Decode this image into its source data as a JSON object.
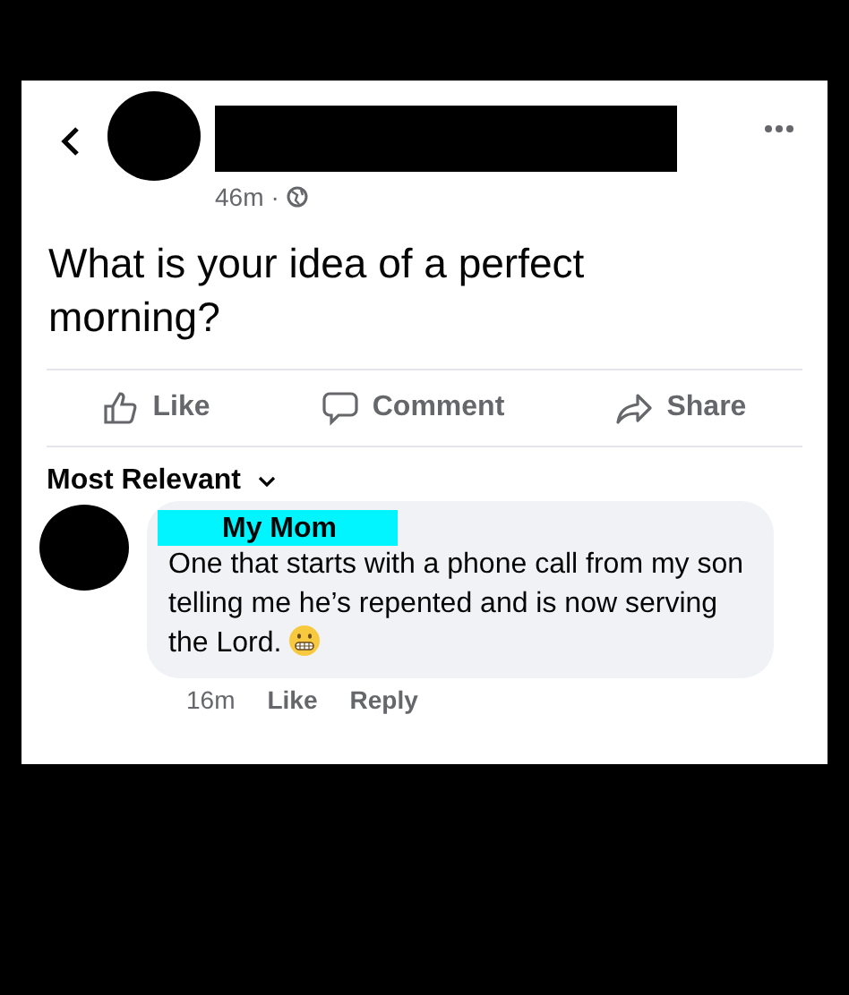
{
  "post": {
    "time": "46m",
    "separator": "·",
    "text": "What is your idea of a perfect morning?"
  },
  "actions": [
    {
      "kind": "like",
      "label": "Like"
    },
    {
      "kind": "comment",
      "label": "Comment"
    },
    {
      "kind": "share",
      "label": "Share"
    }
  ],
  "sort": {
    "label": "Most Relevant"
  },
  "comment": {
    "author": "My Mom",
    "text": "One that starts with a phone call from my son telling me he’s repented and is now serving the Lord.",
    "time": "16m",
    "actions": [
      "Like",
      "Reply"
    ]
  }
}
